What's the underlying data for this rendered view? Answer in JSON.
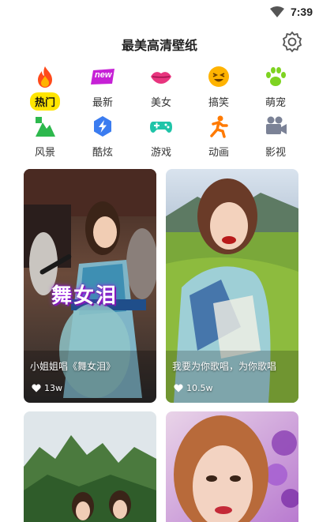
{
  "status": {
    "time": "7:39"
  },
  "header": {
    "title": "最美高清壁纸"
  },
  "categories": [
    {
      "label": "热门",
      "icon": "fire-icon",
      "active": true
    },
    {
      "label": "最新",
      "icon": "new-badge-icon",
      "badge": "new"
    },
    {
      "label": "美女",
      "icon": "lips-icon"
    },
    {
      "label": "搞笑",
      "icon": "laughing-face-icon"
    },
    {
      "label": "萌宠",
      "icon": "paw-icon"
    },
    {
      "label": "风景",
      "icon": "landscape-icon"
    },
    {
      "label": "酷炫",
      "icon": "lightning-icon"
    },
    {
      "label": "游戏",
      "icon": "gamepad-icon"
    },
    {
      "label": "动画",
      "icon": "running-figure-icon"
    },
    {
      "label": "影视",
      "icon": "movie-camera-icon"
    }
  ],
  "cards": [
    {
      "caption": "小姐姐唱《舞女泪》",
      "likes": "13w",
      "overlay": "舞女泪"
    },
    {
      "caption": "我要为你歌唱，为你歌唱",
      "likes": "10.5w"
    },
    {
      "caption": "",
      "likes": ""
    },
    {
      "caption": "",
      "likes": ""
    }
  ],
  "colors": {
    "active_tab": "#ffe500",
    "accent_pink": "#e0207a"
  }
}
